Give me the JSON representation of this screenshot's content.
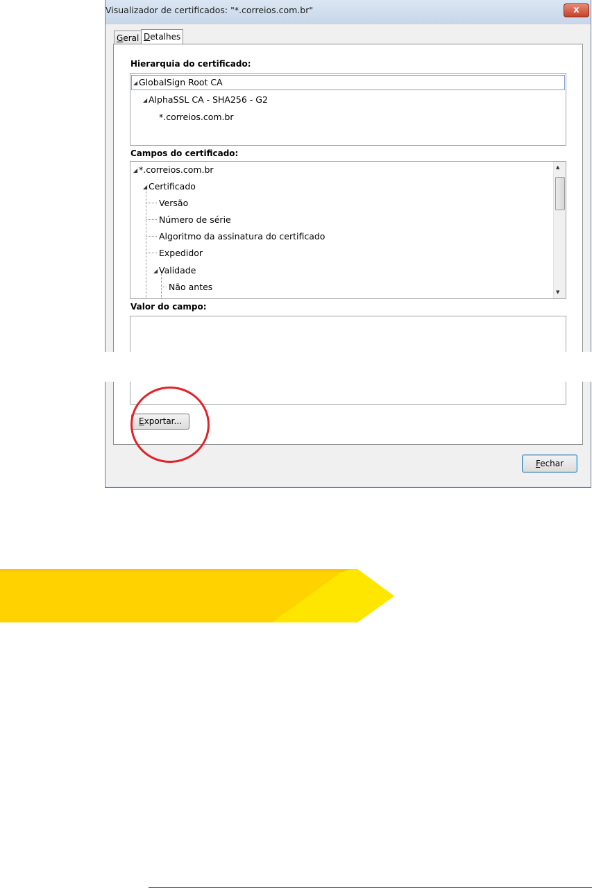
{
  "window": {
    "title": "Visualizador de certificados: \"*.correios.com.br\"",
    "close_label": "x"
  },
  "tabs": [
    {
      "label": "Geral",
      "mnemonic": "G",
      "rest": "eral"
    },
    {
      "label": "Detalhes",
      "mnemonic": "D",
      "rest": "etalhes"
    }
  ],
  "hierarchy": {
    "label": "Hierarquia do certificado:",
    "items": [
      "GlobalSign Root CA",
      "AlphaSSL CA - SHA256 - G2",
      "*.correios.com.br"
    ]
  },
  "fields": {
    "label": "Campos do certificado:",
    "items": [
      "*.correios.com.br",
      "Certificado",
      "Versão",
      "Número de série",
      "Algoritmo da assinatura do certificado",
      "Expedidor",
      "Validade",
      "Não antes"
    ]
  },
  "value": {
    "label": "Valor do campo:",
    "text": ""
  },
  "buttons": {
    "export_mnemonic": "E",
    "export_rest": "xportar...",
    "close_mnemonic": "F",
    "close_rest": "echar"
  },
  "colors": {
    "highlight_circle": "#e22228",
    "banner_yellow": "#ffd400",
    "banner_light": "#ffe600"
  },
  "icons": [
    "expand-triangle-icon",
    "scroll-up-icon",
    "scroll-down-icon",
    "close-icon"
  ]
}
